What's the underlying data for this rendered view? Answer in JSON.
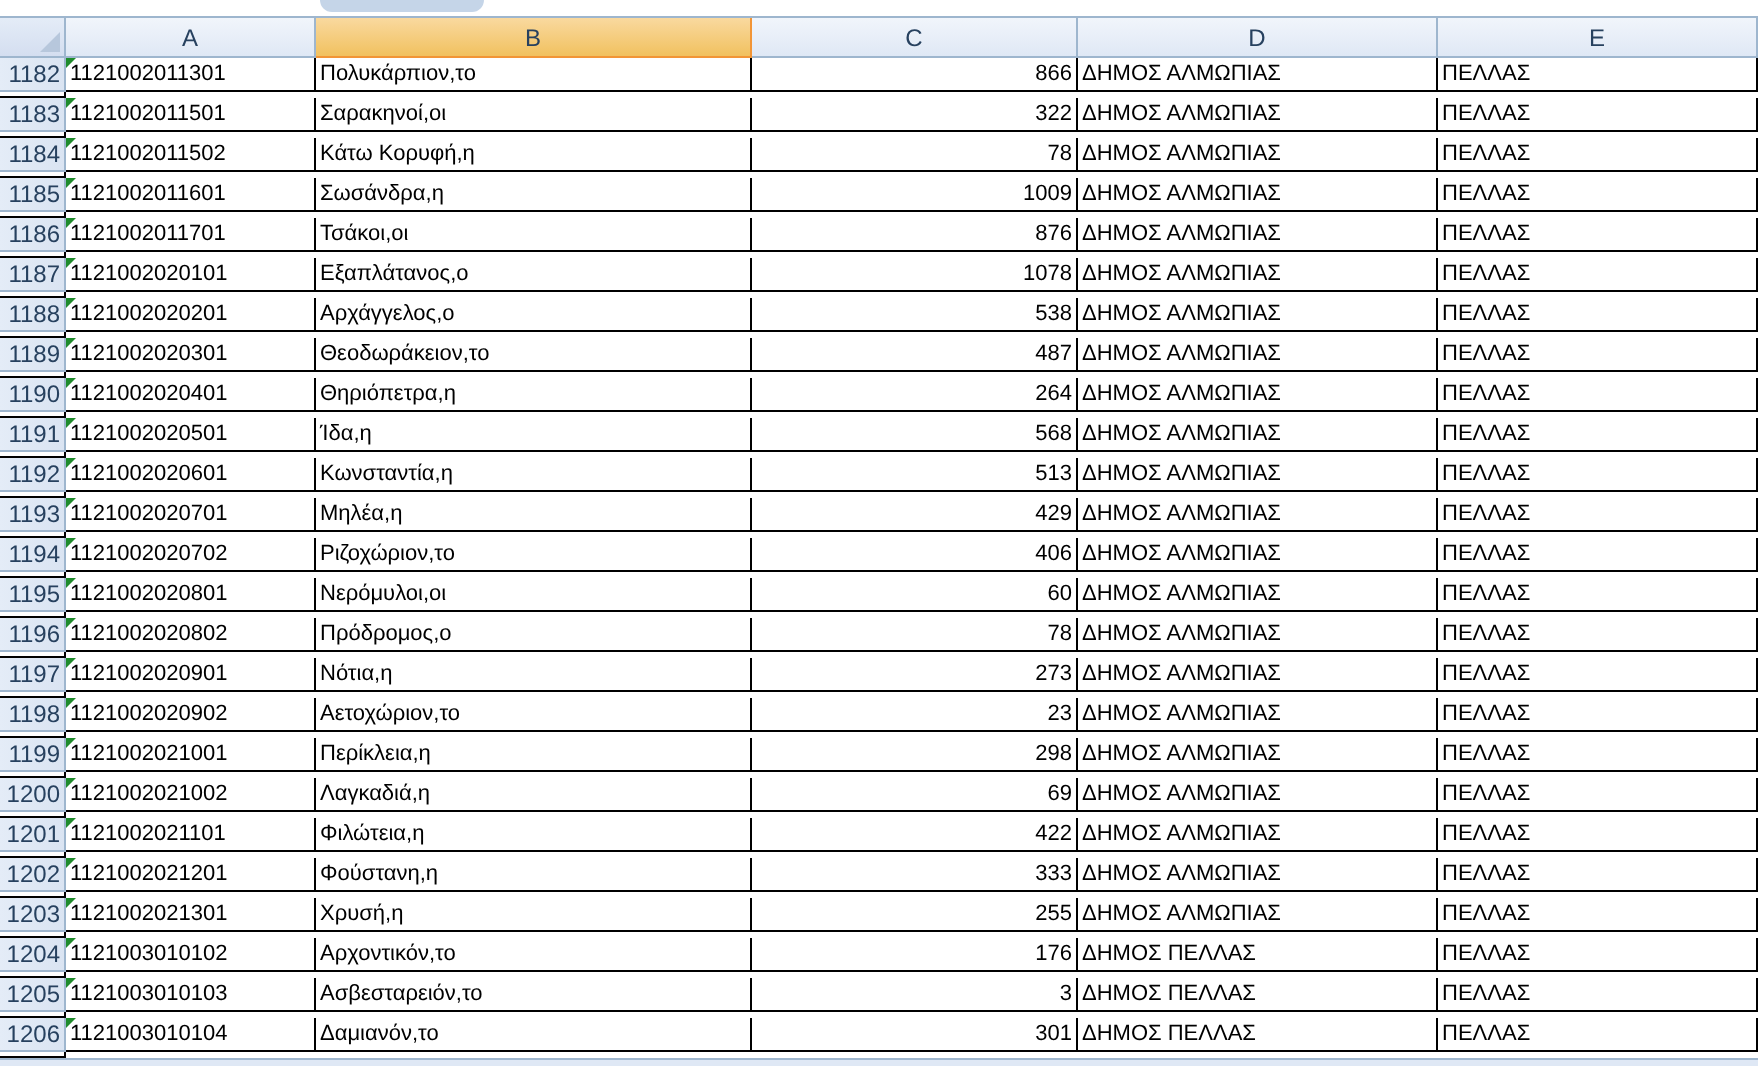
{
  "columns": [
    {
      "label": "A",
      "selected": false
    },
    {
      "label": "B",
      "selected": true
    },
    {
      "label": "C",
      "selected": false
    },
    {
      "label": "D",
      "selected": false
    },
    {
      "label": "E",
      "selected": false
    }
  ],
  "rows": [
    {
      "number": "1182",
      "flagged": true,
      "cells": [
        "1121002011301",
        "Πολυκάρπιον,το",
        "866",
        "ΔΗΜΟΣ ΑΛΜΩΠΙΑΣ",
        "ΠΕΛΛΑΣ"
      ]
    },
    {
      "number": "1183",
      "flagged": true,
      "cells": [
        "1121002011501",
        "Σαρακηνοί,οι",
        "322",
        "ΔΗΜΟΣ ΑΛΜΩΠΙΑΣ",
        "ΠΕΛΛΑΣ"
      ]
    },
    {
      "number": "1184",
      "flagged": true,
      "cells": [
        "1121002011502",
        "Κάτω Κορυφή,η",
        "78",
        "ΔΗΜΟΣ ΑΛΜΩΠΙΑΣ",
        "ΠΕΛΛΑΣ"
      ]
    },
    {
      "number": "1185",
      "flagged": true,
      "cells": [
        "1121002011601",
        "Σωσάνδρα,η",
        "1009",
        "ΔΗΜΟΣ ΑΛΜΩΠΙΑΣ",
        "ΠΕΛΛΑΣ"
      ]
    },
    {
      "number": "1186",
      "flagged": true,
      "cells": [
        "1121002011701",
        "Τσάκοι,οι",
        "876",
        "ΔΗΜΟΣ ΑΛΜΩΠΙΑΣ",
        "ΠΕΛΛΑΣ"
      ]
    },
    {
      "number": "1187",
      "flagged": true,
      "cells": [
        "1121002020101",
        "Εξαπλάτανος,ο",
        "1078",
        "ΔΗΜΟΣ ΑΛΜΩΠΙΑΣ",
        "ΠΕΛΛΑΣ"
      ]
    },
    {
      "number": "1188",
      "flagged": true,
      "cells": [
        "1121002020201",
        "Αρχάγγελος,ο",
        "538",
        "ΔΗΜΟΣ ΑΛΜΩΠΙΑΣ",
        "ΠΕΛΛΑΣ"
      ]
    },
    {
      "number": "1189",
      "flagged": true,
      "cells": [
        "1121002020301",
        "Θεοδωράκειον,το",
        "487",
        "ΔΗΜΟΣ ΑΛΜΩΠΙΑΣ",
        "ΠΕΛΛΑΣ"
      ]
    },
    {
      "number": "1190",
      "flagged": true,
      "cells": [
        "1121002020401",
        "Θηριόπετρα,η",
        "264",
        "ΔΗΜΟΣ ΑΛΜΩΠΙΑΣ",
        "ΠΕΛΛΑΣ"
      ]
    },
    {
      "number": "1191",
      "flagged": true,
      "cells": [
        "1121002020501",
        "Ίδα,η",
        "568",
        "ΔΗΜΟΣ ΑΛΜΩΠΙΑΣ",
        "ΠΕΛΛΑΣ"
      ]
    },
    {
      "number": "1192",
      "flagged": true,
      "cells": [
        "1121002020601",
        "Κωνσταντία,η",
        "513",
        "ΔΗΜΟΣ ΑΛΜΩΠΙΑΣ",
        "ΠΕΛΛΑΣ"
      ]
    },
    {
      "number": "1193",
      "flagged": true,
      "cells": [
        "1121002020701",
        "Μηλέα,η",
        "429",
        "ΔΗΜΟΣ ΑΛΜΩΠΙΑΣ",
        "ΠΕΛΛΑΣ"
      ]
    },
    {
      "number": "1194",
      "flagged": true,
      "cells": [
        "1121002020702",
        "Ριζοχώριον,το",
        "406",
        "ΔΗΜΟΣ ΑΛΜΩΠΙΑΣ",
        "ΠΕΛΛΑΣ"
      ]
    },
    {
      "number": "1195",
      "flagged": true,
      "cells": [
        "1121002020801",
        "Νερόμυλοι,οι",
        "60",
        "ΔΗΜΟΣ ΑΛΜΩΠΙΑΣ",
        "ΠΕΛΛΑΣ"
      ]
    },
    {
      "number": "1196",
      "flagged": true,
      "cells": [
        "1121002020802",
        "Πρόδρομος,ο",
        "78",
        "ΔΗΜΟΣ ΑΛΜΩΠΙΑΣ",
        "ΠΕΛΛΑΣ"
      ]
    },
    {
      "number": "1197",
      "flagged": true,
      "cells": [
        "1121002020901",
        "Νότια,η",
        "273",
        "ΔΗΜΟΣ ΑΛΜΩΠΙΑΣ",
        "ΠΕΛΛΑΣ"
      ]
    },
    {
      "number": "1198",
      "flagged": true,
      "cells": [
        "1121002020902",
        "Αετοχώριον,το",
        "23",
        "ΔΗΜΟΣ ΑΛΜΩΠΙΑΣ",
        "ΠΕΛΛΑΣ"
      ]
    },
    {
      "number": "1199",
      "flagged": true,
      "cells": [
        "1121002021001",
        "Περίκλεια,η",
        "298",
        "ΔΗΜΟΣ ΑΛΜΩΠΙΑΣ",
        "ΠΕΛΛΑΣ"
      ]
    },
    {
      "number": "1200",
      "flagged": true,
      "cells": [
        "1121002021002",
        "Λαγκαδιά,η",
        "69",
        "ΔΗΜΟΣ ΑΛΜΩΠΙΑΣ",
        "ΠΕΛΛΑΣ"
      ]
    },
    {
      "number": "1201",
      "flagged": true,
      "cells": [
        "1121002021101",
        "Φιλώτεια,η",
        "422",
        "ΔΗΜΟΣ ΑΛΜΩΠΙΑΣ",
        "ΠΕΛΛΑΣ"
      ]
    },
    {
      "number": "1202",
      "flagged": true,
      "cells": [
        "1121002021201",
        "Φούστανη,η",
        "333",
        "ΔΗΜΟΣ ΑΛΜΩΠΙΑΣ",
        "ΠΕΛΛΑΣ"
      ]
    },
    {
      "number": "1203",
      "flagged": true,
      "cells": [
        "1121002021301",
        "Χρυσή,η",
        "255",
        "ΔΗΜΟΣ ΑΛΜΩΠΙΑΣ",
        "ΠΕΛΛΑΣ"
      ]
    },
    {
      "number": "1204",
      "flagged": true,
      "cells": [
        "1121003010102",
        "Αρχοντικόν,το",
        "176",
        "ΔΗΜΟΣ ΠΕΛΛΑΣ",
        "ΠΕΛΛΑΣ"
      ]
    },
    {
      "number": "1205",
      "flagged": true,
      "cells": [
        "1121003010103",
        "Ασβεσταρειόν,το",
        "3",
        "ΔΗΜΟΣ ΠΕΛΛΑΣ",
        "ΠΕΛΛΑΣ"
      ]
    },
    {
      "number": "1206",
      "flagged": true,
      "cells": [
        "1121003010104",
        "Δαμιανόν,το",
        "301",
        "ΔΗΜΟΣ ΠΕΛΛΑΣ",
        "ΠΕΛΛΑΣ"
      ]
    }
  ]
}
